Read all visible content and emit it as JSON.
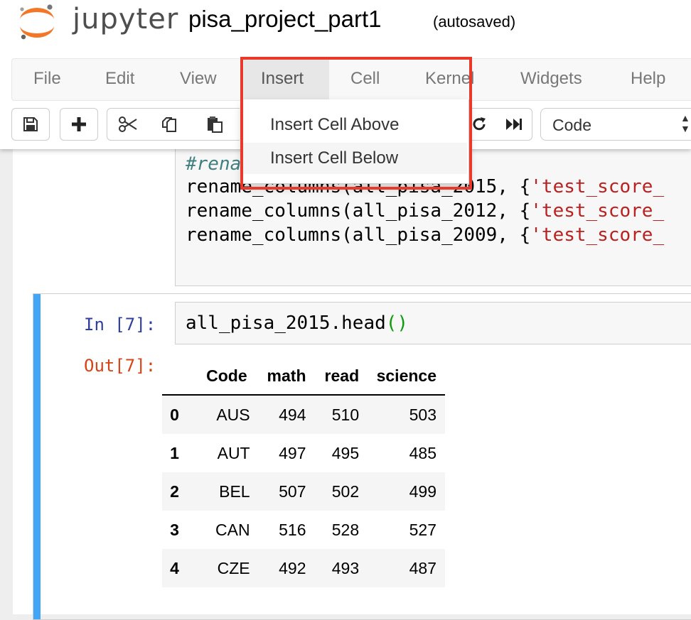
{
  "header": {
    "logo_text": "jupyter",
    "notebook_title": "pisa_project_part1",
    "save_status": "(autosaved)"
  },
  "menubar": {
    "items": [
      "File",
      "Edit",
      "View",
      "Insert",
      "Cell",
      "Kernel",
      "Widgets",
      "Help"
    ],
    "active": "Insert"
  },
  "toolbar": {
    "buttons": [
      "save-icon",
      "plus-icon",
      "scissors-icon",
      "copy-icon",
      "paste-icon",
      "refresh-icon",
      "fast-forward-icon"
    ],
    "cell_type": "Code"
  },
  "dropdown": {
    "items": [
      "Insert Cell Above",
      "Insert Cell Below"
    ],
    "hovered": "Insert Cell Below"
  },
  "accent_colors": {
    "highlight_box": "#e8392b",
    "selected_cell_bar": "#42a5f5",
    "in_prompt": "#303f9f",
    "out_prompt": "#d84315"
  },
  "cell1": {
    "comment": "#rena",
    "lines": [
      {
        "call": "rename_columns(all_pisa_2015, {",
        "string": "'test_score_"
      },
      {
        "call": "rename_columns(all_pisa_2012, {",
        "string": "'test_score_"
      },
      {
        "call": "rename_columns(all_pisa_2009, {",
        "string": "'test_score_"
      }
    ]
  },
  "cell2": {
    "in_prompt": "In [7]:",
    "code": "all_pisa_2015.head",
    "code_parens": "()",
    "out_prompt": "Out[7]:",
    "table": {
      "columns": [
        "",
        "Code",
        "math",
        "read",
        "science"
      ],
      "rows": [
        [
          "0",
          "AUS",
          "494",
          "510",
          "503"
        ],
        [
          "1",
          "AUT",
          "497",
          "495",
          "485"
        ],
        [
          "2",
          "BEL",
          "507",
          "502",
          "499"
        ],
        [
          "3",
          "CAN",
          "516",
          "528",
          "527"
        ],
        [
          "4",
          "CZE",
          "492",
          "493",
          "487"
        ]
      ]
    }
  }
}
